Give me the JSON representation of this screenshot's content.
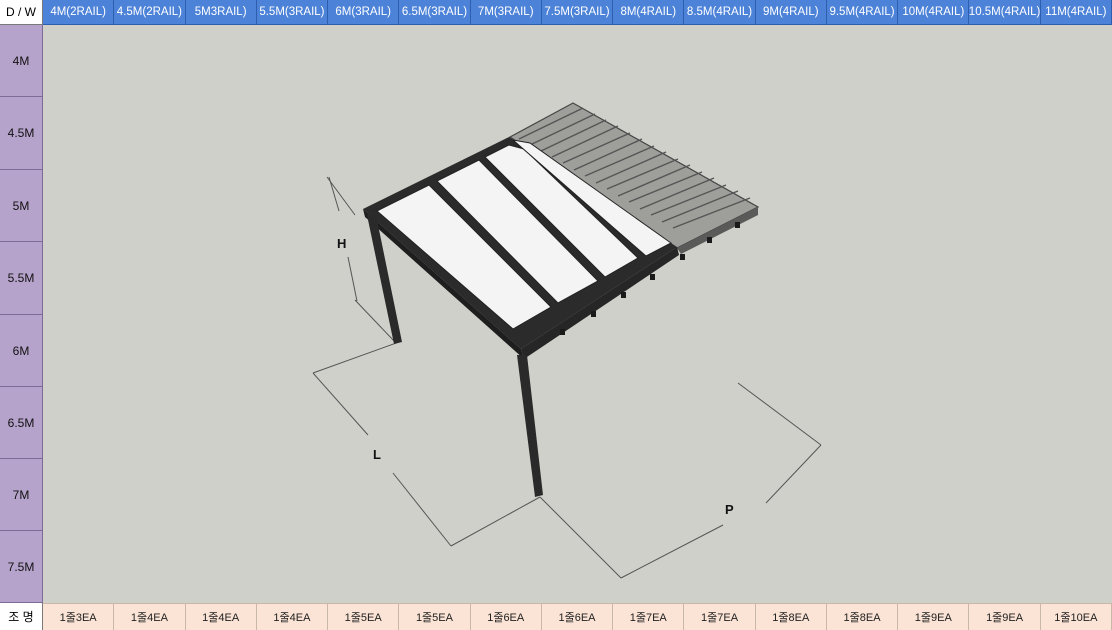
{
  "corner_label": "D / W",
  "width_headers": [
    "4M(2RAIL)",
    "4.5M(2RAIL)",
    "5M3RAIL)",
    "5.5M(3RAIL)",
    "6M(3RAIL)",
    "6.5M(3RAIL)",
    "7M(3RAIL)",
    "7.5M(3RAIL)",
    "8M(4RAIL)",
    "8.5M(4RAIL)",
    "9M(4RAIL)",
    "9.5M(4RAIL)",
    "10M(4RAIL)",
    "10.5M(4RAIL)",
    "11M(4RAIL)"
  ],
  "depth_headers": [
    "4M",
    "4.5M",
    "5M",
    "5.5M",
    "6M",
    "6.5M",
    "7M",
    "7.5M"
  ],
  "footer_label": "조 명",
  "footer_values": [
    "1줄3EA",
    "1줄4EA",
    "1줄4EA",
    "1줄4EA",
    "1줄5EA",
    "1줄5EA",
    "1줄6EA",
    "1줄6EA",
    "1줄7EA",
    "1줄7EA",
    "1줄8EA",
    "1줄8EA",
    "1줄9EA",
    "1줄9EA",
    "1줄10EA"
  ],
  "dimensions": {
    "h": "H",
    "l": "L",
    "p": "P"
  },
  "colors": {
    "column_header": "#4c82d8",
    "row_header": "#b6a3cc",
    "footer": "#fbe4d5",
    "canvas": "#d0d0cb"
  }
}
